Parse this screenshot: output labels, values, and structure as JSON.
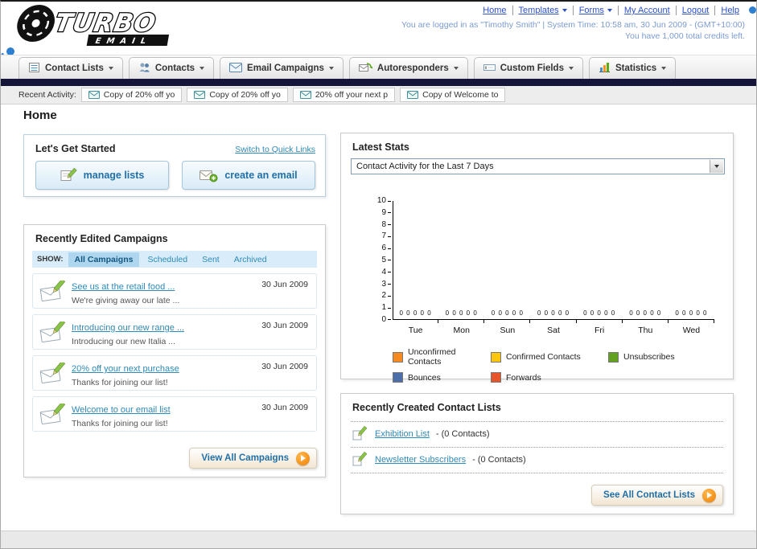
{
  "colors": {
    "top_link_blue": "#2d4fc4",
    "app_link_blue": "#2e8ab8",
    "dark_bar_navy": "#15153a",
    "accent_orange": "#f7941d"
  },
  "header": {
    "logo_primary": "TURBO",
    "logo_secondary": "EMAIL",
    "top_links": [
      "Home",
      "Templates",
      "Forms",
      "My Account",
      "Logout",
      "Help"
    ],
    "login_info": "You are logged in as \"Timothy Smith\" | System Time: 10:58 am, 30 Jun 2009 - (GMT+10:00)",
    "credits_info": "You have 1,000 total credits left."
  },
  "nav": {
    "tabs": [
      {
        "label": "Contact Lists",
        "icon": "contact-lists-icon"
      },
      {
        "label": "Contacts",
        "icon": "contacts-icon"
      },
      {
        "label": "Email Campaigns",
        "icon": "email-campaigns-icon"
      },
      {
        "label": "Autoresponders",
        "icon": "autoresponders-icon"
      },
      {
        "label": "Custom Fields",
        "icon": "custom-fields-icon"
      },
      {
        "label": "Statistics",
        "icon": "statistics-icon"
      }
    ]
  },
  "recent_activity": {
    "label": "Recent Activity:",
    "items": [
      "Copy of 20% off yo",
      "Copy of 20% off yo",
      "20% off your next p",
      "Copy of Welcome to"
    ]
  },
  "page_title": "Home",
  "get_started": {
    "title": "Let's Get Started",
    "switch_link": "Switch to Quick Links",
    "buttons": [
      {
        "label": "manage lists",
        "icon": "pencil-pad-icon"
      },
      {
        "label": "create an email",
        "icon": "envelope-plus-icon"
      }
    ]
  },
  "campaigns": {
    "title": "Recently Edited Campaigns",
    "show_label": "SHOW:",
    "filters": [
      "All Campaigns",
      "Scheduled",
      "Sent",
      "Archived"
    ],
    "active_filter": "All Campaigns",
    "items": [
      {
        "title": "See us at the retail food ...",
        "subtitle": "We're giving away our late ...",
        "date": "30 Jun 2009"
      },
      {
        "title": "Introducing our new range ...",
        "subtitle": "Introducing our new Italia ...",
        "date": "30 Jun 2009"
      },
      {
        "title": "20% off your next purchase",
        "subtitle": "Thanks for joining our list!",
        "date": "30 Jun 2009"
      },
      {
        "title": "Welcome to our email list",
        "subtitle": "Thanks for joining our list!",
        "date": "30 Jun 2009"
      }
    ],
    "view_all_label": "View All Campaigns"
  },
  "latest_stats": {
    "title": "Latest Stats",
    "dropdown_value": "Contact Activity for the Last 7 Days",
    "chart_data": {
      "type": "bar",
      "title": "Contact Activity for the Last 7 Days",
      "categories": [
        "Tue",
        "Mon",
        "Sun",
        "Sat",
        "Fri",
        "Thu",
        "Wed"
      ],
      "series": [
        {
          "name": "Unconfirmed Contacts",
          "color": "#f6891f",
          "values": [
            0,
            0,
            0,
            0,
            0,
            0,
            0
          ]
        },
        {
          "name": "Confirmed Contacts",
          "color": "#fdc50e",
          "values": [
            0,
            0,
            0,
            0,
            0,
            0,
            0
          ]
        },
        {
          "name": "Unsubscribes",
          "color": "#63a121",
          "values": [
            0,
            0,
            0,
            0,
            0,
            0,
            0
          ]
        },
        {
          "name": "Bounces",
          "color": "#4d6fa9",
          "values": [
            0,
            0,
            0,
            0,
            0,
            0,
            0
          ]
        },
        {
          "name": "Forwards",
          "color": "#e8542a",
          "values": [
            0,
            0,
            0,
            0,
            0,
            0,
            0
          ]
        }
      ],
      "ylim": [
        0,
        10
      ],
      "yticks": [
        10,
        9,
        8,
        7,
        6,
        5,
        4,
        3,
        2,
        1,
        0
      ],
      "grid": false,
      "legend_position": "bottom"
    }
  },
  "contact_lists": {
    "title": "Recently Created Contact Lists",
    "items": [
      {
        "name": "Exhibition List",
        "detail": "- (0 Contacts)"
      },
      {
        "name": "Newsletter Subscribers",
        "detail": "- (0 Contacts)"
      }
    ],
    "see_all_label": "See All Contact Lists"
  }
}
